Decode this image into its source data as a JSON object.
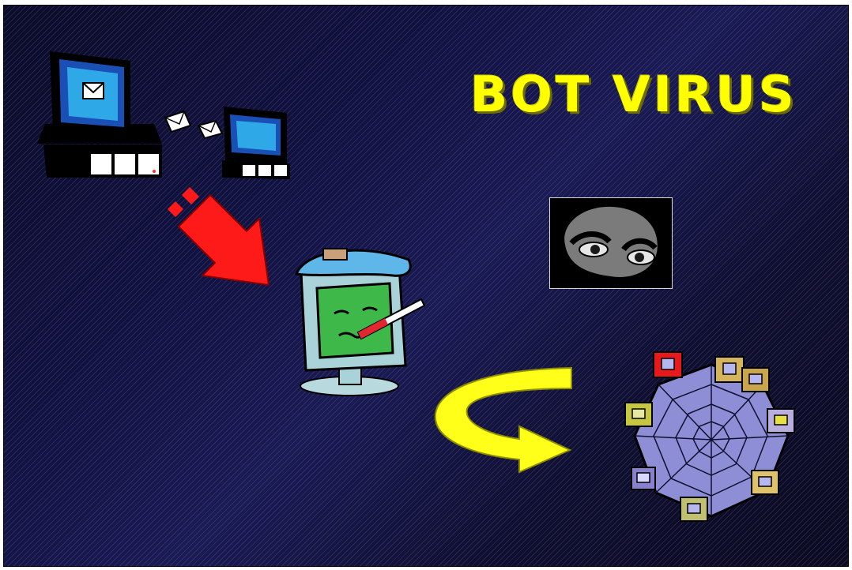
{
  "slide": {
    "title": "BOT VIRUS",
    "background_color": "#15153f",
    "title_color": "#ffff00"
  },
  "illustrations": {
    "mail_transfer": {
      "icons": [
        "computer-icon",
        "envelope-icon",
        "envelope-icon",
        "computer-icon"
      ]
    },
    "infection_arrow": {
      "icon": "arrow-icon",
      "color": "#ff0000"
    },
    "sick_computer": {
      "icon": "sick-computer-icon",
      "screen_color": "#3fb84a"
    },
    "hacker_eyes": {
      "icon": "eyes-icon"
    },
    "spread_arrow": {
      "icon": "curved-arrow-icon",
      "color": "#ffff1a"
    },
    "botnet": {
      "icon": "spider-web-network-icon",
      "node_colors": [
        "#e8191c",
        "#d4b45c",
        "#c9a64e",
        "#b8aee0",
        "#e0c26a",
        "#c0c070",
        "#8a80d0",
        "#c7c640"
      ]
    }
  }
}
